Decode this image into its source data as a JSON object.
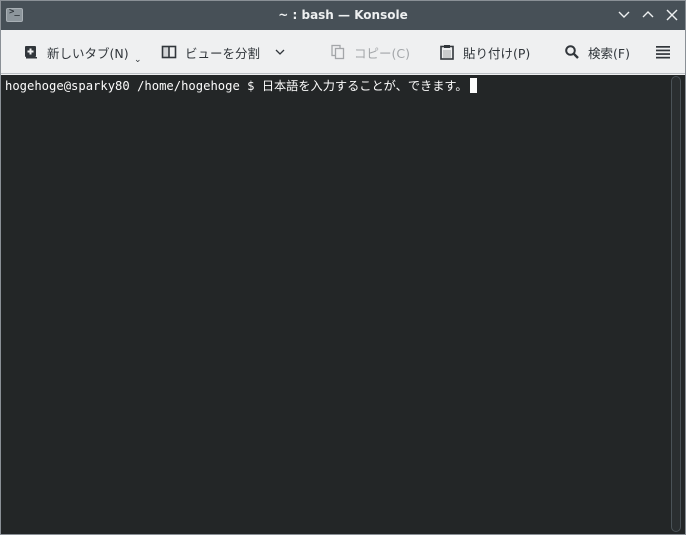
{
  "window": {
    "title": "~ : bash — Konsole"
  },
  "toolbar": {
    "new_tab_label": "新しいタブ(N)",
    "split_view_label": "ビューを分割",
    "copy_label": "コピー(C)",
    "paste_label": "貼り付け(P)",
    "find_label": "検索(F)"
  },
  "icons": {
    "app": "terminal-icon",
    "minimize": "chevron-down-icon",
    "maximize": "chevron-up-icon",
    "close": "close-icon",
    "new_tab": "new-tab-icon",
    "split_view": "split-view-icon",
    "copy": "copy-icon",
    "paste": "paste-icon",
    "find": "search-icon",
    "menu": "hamburger-menu-icon"
  },
  "terminal": {
    "prompt": "hogehoge@sparky80 /home/hogehoge $ ",
    "input": "日本語を入力することが、できます。"
  },
  "colors": {
    "titlebar_bg": "#475057",
    "toolbar_bg": "#eff0f1",
    "terminal_bg": "#232627",
    "terminal_fg": "#fcfcfc"
  }
}
